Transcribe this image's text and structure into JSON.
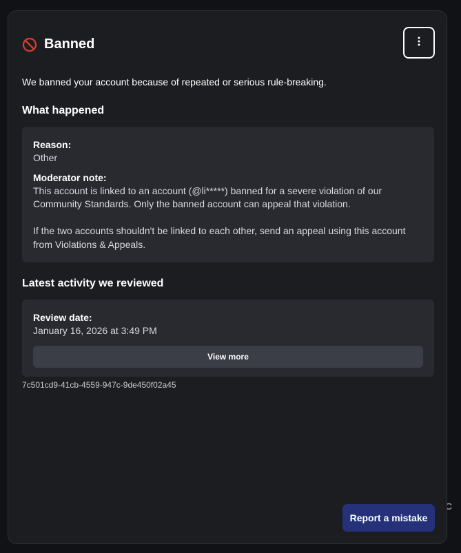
{
  "background": {
    "peek_text": "C"
  },
  "header": {
    "title": "Banned",
    "icon": "ban-icon",
    "menu_icon": "more-vertical-icon"
  },
  "intro": "We banned your account because of repeated or serious rule-breaking.",
  "what_happened": {
    "heading": "What happened",
    "reason_label": "Reason:",
    "reason_value": "Other",
    "note_label": "Moderator note:",
    "note_lines": [
      "This account is linked to an account (@li*****) banned for a severe violation of our",
      "Community Standards. Only the banned account can appeal that violation.",
      "If the two accounts shouldn't be linked to each other, send an appeal using this account",
      "from Violations & Appeals."
    ]
  },
  "latest_activity": {
    "heading": "Latest activity we reviewed",
    "review_date_label": "Review date:",
    "review_date_value": "January 16, 2026 at 3:49 PM",
    "view_more_label": "View more"
  },
  "reference_id": "7c501cd9-41cb-4559-947c-9de450f02a45",
  "footer": {
    "report_label": "Report a mistake"
  },
  "colors": {
    "modal_bg": "#1c1d21",
    "card_bg": "#282a30",
    "ban_icon": "#d9402b",
    "primary_button": "#25327a",
    "secondary_button": "#3b3e47"
  }
}
